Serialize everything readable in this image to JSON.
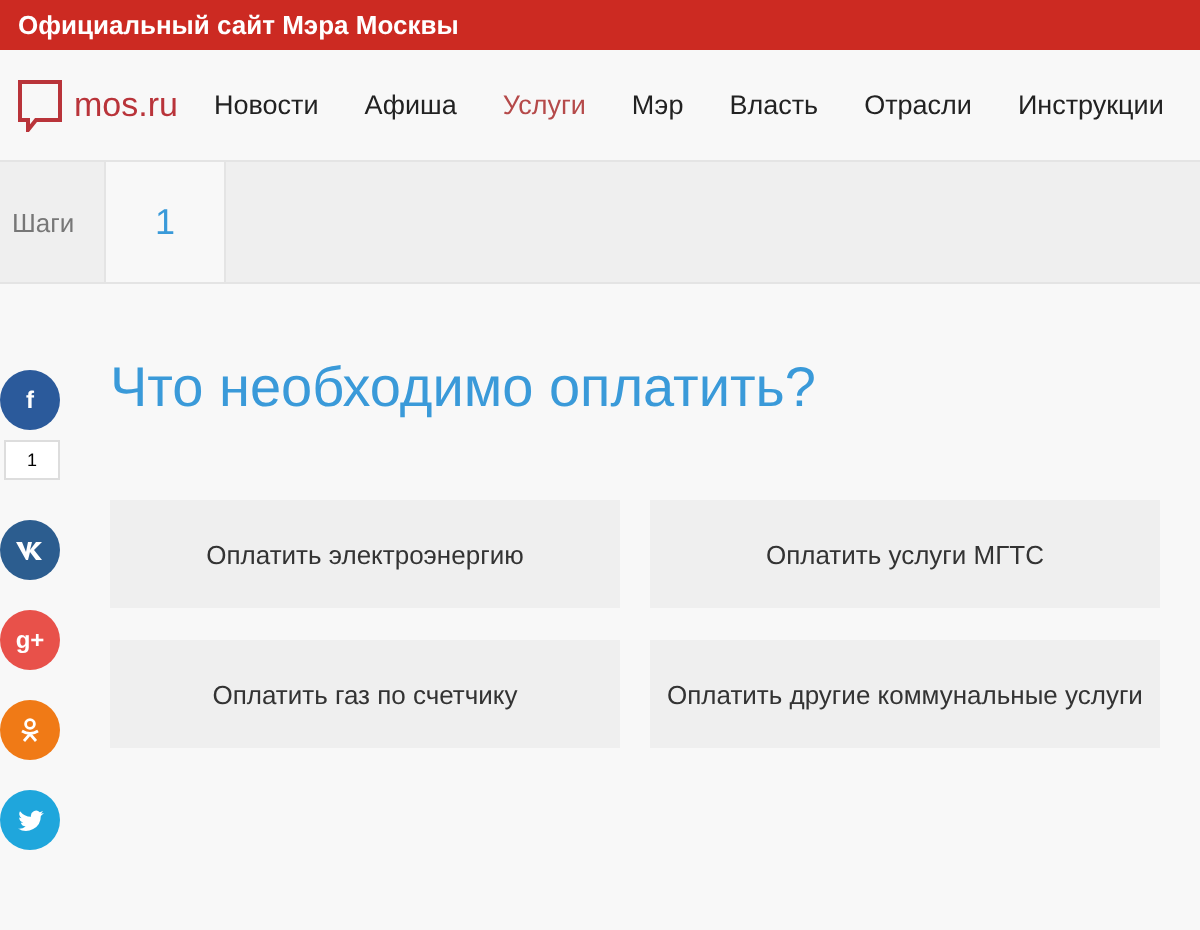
{
  "top_bar": {
    "title": "Официальный сайт Мэра Москвы"
  },
  "header": {
    "logo": "mos.ru",
    "nav": [
      {
        "label": "Новости",
        "selected": false
      },
      {
        "label": "Афиша",
        "selected": false
      },
      {
        "label": "Услуги",
        "selected": true
      },
      {
        "label": "Мэр",
        "selected": false
      },
      {
        "label": "Власть",
        "selected": false
      },
      {
        "label": "Отрасли",
        "selected": false
      },
      {
        "label": "Инструкции",
        "selected": false
      }
    ]
  },
  "steps": {
    "label": "Шаги",
    "items": [
      {
        "label": "1",
        "selected": true
      }
    ]
  },
  "social": [
    {
      "kind": "facebook",
      "glyph": "f",
      "color": "#2b5a9b",
      "count": "1"
    },
    {
      "kind": "vk",
      "color": "#2c5d8f"
    },
    {
      "kind": "googleplus",
      "glyph": "g+",
      "color": "#e8514a"
    },
    {
      "kind": "ok",
      "color": "#f07a16"
    },
    {
      "kind": "twitter",
      "color": "#1fa6dc"
    }
  ],
  "heading": "Что необходимо оплатить?",
  "options": [
    "Оплатить электроэнергию",
    "Оплатить услуги МГТС",
    "Оплатить газ по счетчику",
    "Оплатить другие коммунальные услуги"
  ]
}
